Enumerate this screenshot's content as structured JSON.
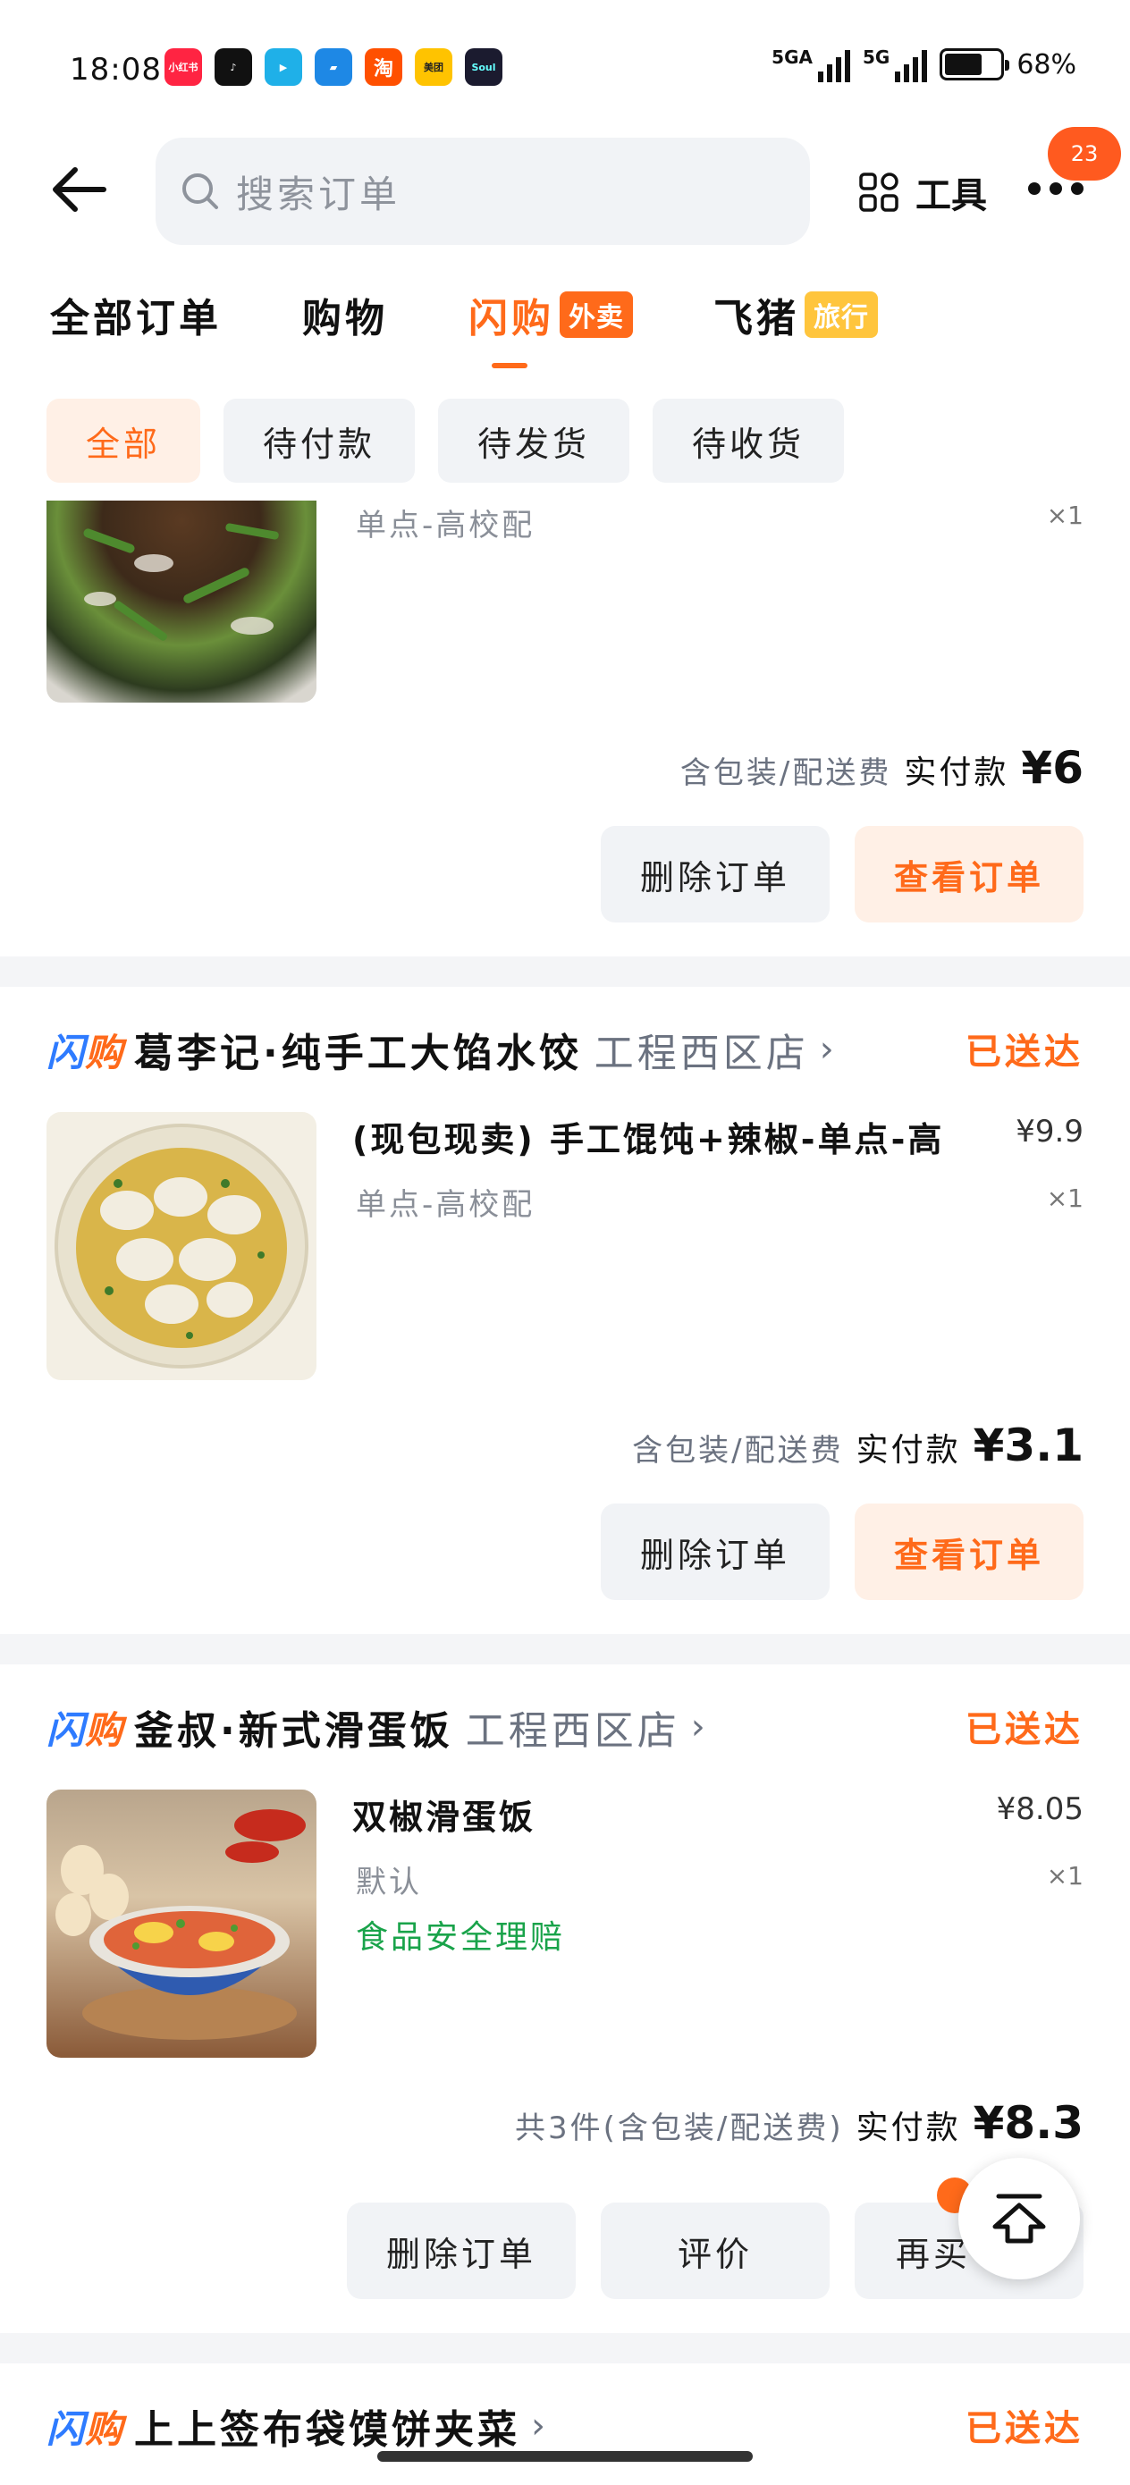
{
  "status_bar": {
    "time": "18:08",
    "apps": [
      {
        "name": "小红书",
        "color": "#ff2442"
      },
      {
        "name": "抖音",
        "color": "#111111"
      },
      {
        "name": "视频",
        "color": "#1fb0e8"
      },
      {
        "name": "书",
        "color": "#1e88e5"
      },
      {
        "name": "淘",
        "color": "#ff5000"
      },
      {
        "name": "美团",
        "color": "#ffc300"
      },
      {
        "name": "Soul",
        "color": "#1b1b2f"
      }
    ],
    "net1": "5GA",
    "net2": "5G",
    "battery": "68%",
    "battery_level": 0.68
  },
  "header": {
    "search_placeholder": "搜索订单",
    "tools_label": "工具",
    "badge": "23"
  },
  "tabs": [
    {
      "label": "全部订单",
      "tag": ""
    },
    {
      "label": "购物",
      "tag": ""
    },
    {
      "label": "闪购",
      "tag": "外卖"
    },
    {
      "label": "飞猪",
      "tag": "旅行"
    }
  ],
  "filters": [
    "全部",
    "待付款",
    "待发货",
    "待收货"
  ],
  "orders": [
    {
      "store": "",
      "branch": "",
      "status": "",
      "item_name": "",
      "spec": "单点-高校配",
      "price": "",
      "qty": "×1",
      "insure": "",
      "note": "含包装/配送费",
      "total_label": "实付款",
      "total": "¥6",
      "buttons": [
        "删除订单",
        "查看订单"
      ]
    },
    {
      "store": "葛李记·纯手工大馅水饺",
      "branch": "工程西区店",
      "status": "已送达",
      "item_name": "(现包现卖) 手工馄饨+辣椒-单点-高",
      "spec": "单点-高校配",
      "price": "¥9.9",
      "qty": "×1",
      "insure": "",
      "note": "含包装/配送费",
      "total_label": "实付款",
      "total": "¥3.1",
      "buttons": [
        "删除订单",
        "查看订单"
      ]
    },
    {
      "store": "釜叔·新式滑蛋饭",
      "branch": "工程西区店",
      "status": "已送达",
      "item_name": "双椒滑蛋饭",
      "spec": "默认",
      "price": "¥8.05",
      "qty": "×1",
      "insure": "食品安全理赔",
      "note": "共3件(含包装/配送费)",
      "total_label": "实付款",
      "total": "¥8.3",
      "buttons": [
        "删除订单",
        "评价",
        "再买"
      ]
    },
    {
      "store": "上上签布袋馍饼夹菜",
      "branch": "",
      "status": "已送达"
    }
  ],
  "brand": {
    "logo_a": "闪",
    "logo_b": "购"
  },
  "colors": {
    "accent": "#ff6a1a",
    "green": "#19a34a",
    "blue": "#2e7bff"
  }
}
